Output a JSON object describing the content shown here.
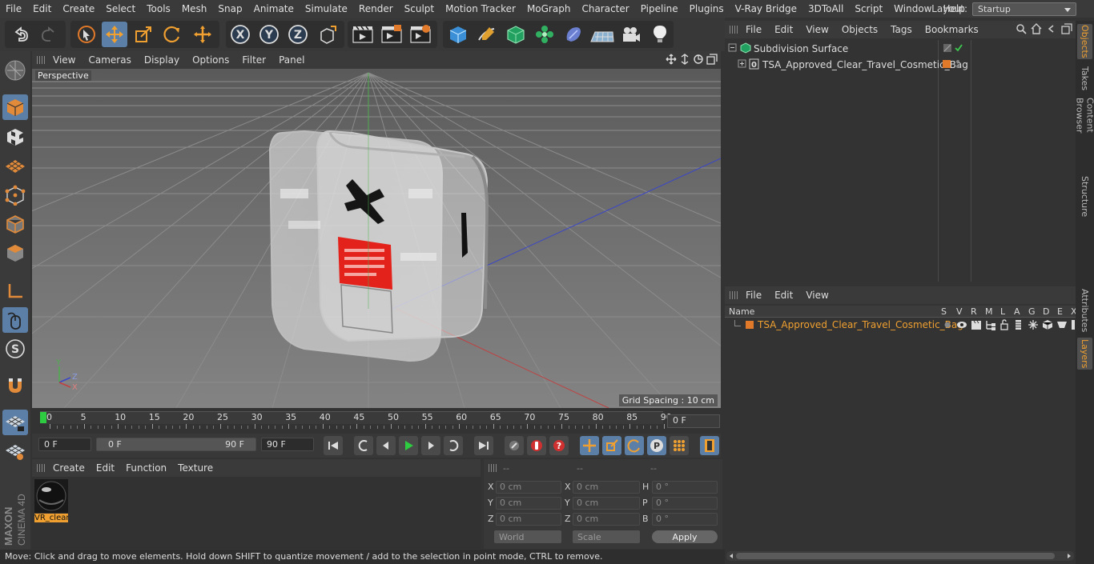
{
  "menubar": {
    "items": [
      "File",
      "Edit",
      "Create",
      "Select",
      "Tools",
      "Mesh",
      "Snap",
      "Animate",
      "Simulate",
      "Render",
      "Sculpt",
      "Motion Tracker",
      "MoGraph",
      "Character",
      "Pipeline",
      "Plugins",
      "V-Ray Bridge",
      "3DToAll",
      "Script",
      "Window",
      "Help"
    ],
    "layout_label": "Layout:",
    "layout_value": "Startup"
  },
  "viewport": {
    "menu": [
      "View",
      "Cameras",
      "Display",
      "Options",
      "Filter",
      "Panel"
    ],
    "camera_label": "Perspective",
    "grid_spacing": "Grid Spacing : 10 cm",
    "axis_y": "Y",
    "axis_x": "X",
    "axis_z": "Z"
  },
  "timeline": {
    "ticks": [
      "0",
      "5",
      "10",
      "15",
      "20",
      "25",
      "30",
      "35",
      "40",
      "45",
      "50",
      "55",
      "60",
      "65",
      "70",
      "75",
      "80",
      "85",
      "90"
    ],
    "current_frame": "0 F"
  },
  "playbar": {
    "start_field": "0 F",
    "range_start": "0 F",
    "range_end": "90 F",
    "end_field": "90 F"
  },
  "material_panel": {
    "menu": [
      "Create",
      "Edit",
      "Function",
      "Texture"
    ],
    "material_name": "VR_clear"
  },
  "coords": {
    "headers": [
      "--",
      "--",
      "--"
    ],
    "rows": [
      {
        "l1": "X",
        "v1": "0 cm",
        "l2": "X",
        "v2": "0 cm",
        "l3": "H",
        "v3": "0 °"
      },
      {
        "l1": "Y",
        "v1": "0 cm",
        "l2": "Y",
        "v2": "0 cm",
        "l3": "P",
        "v3": "0 °"
      },
      {
        "l1": "Z",
        "v1": "0 cm",
        "l2": "Z",
        "v2": "0 cm",
        "l3": "B",
        "v3": "0 °"
      }
    ],
    "world": "World",
    "scale": "Scale",
    "apply": "Apply"
  },
  "status": "Move: Click and drag to move elements. Hold down SHIFT to quantize movement / add to the selection in point mode, CTRL to remove.",
  "objects_panel": {
    "menu": [
      "File",
      "Edit",
      "View",
      "Objects",
      "Tags",
      "Bookmarks"
    ],
    "items": [
      "Subdivision Surface",
      "TSA_Approved_Clear_Travel_Cosmetic_Bag"
    ]
  },
  "layers_panel": {
    "menu": [
      "File",
      "Edit",
      "View"
    ],
    "col_name": "Name",
    "cols": [
      "S",
      "V",
      "R",
      "M",
      "L",
      "A",
      "G",
      "D",
      "E",
      "X"
    ],
    "layer_name": "TSA_Approved_Clear_Travel_Cosmetic_Bag"
  },
  "side_tabs": [
    "Objects",
    "Takes",
    "Content Browser",
    "Structure",
    "Attributes",
    "Layers"
  ],
  "brand": {
    "maxon": "MAXON",
    "cinema": "CINEMA 4D"
  },
  "colors": {
    "accent": "#5c7fa8",
    "orange": "#e07a2a",
    "highlight": "#f0a030"
  }
}
